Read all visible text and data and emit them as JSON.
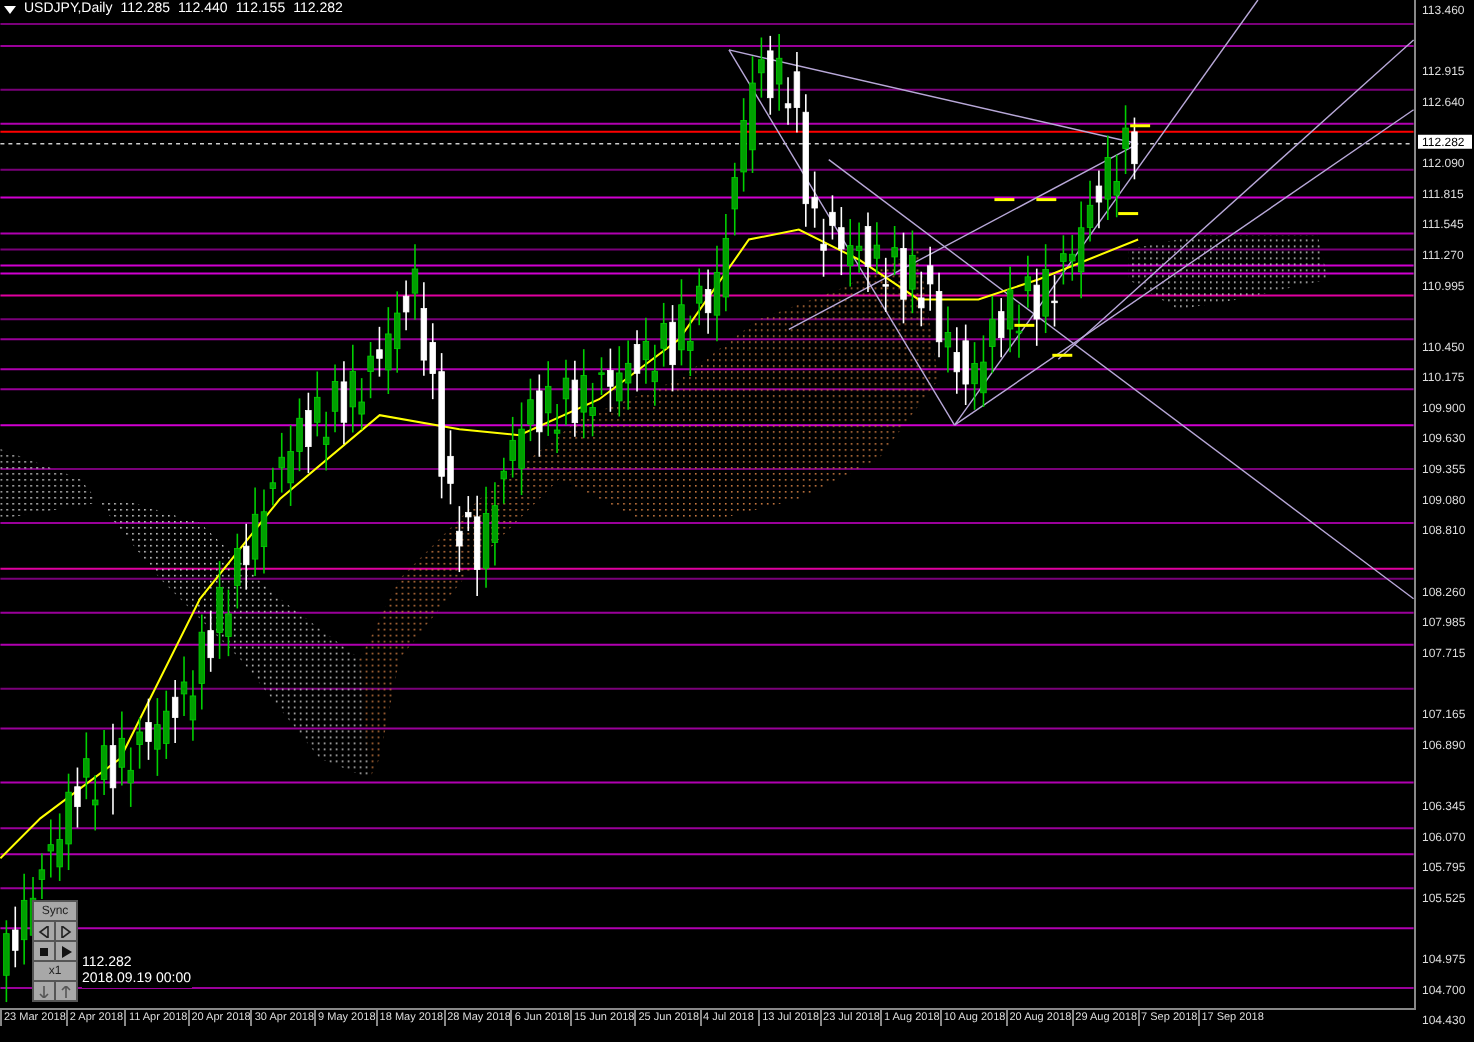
{
  "chart": {
    "symbol_title": "USDJPY,Daily",
    "ohlc": [
      "112.285",
      "112.440",
      "112.155",
      "112.282"
    ]
  },
  "price_axis": {
    "labels": [
      "113.460",
      "112.915",
      "112.640",
      "112.090",
      "111.815",
      "111.545",
      "111.270",
      "110.995",
      "110.450",
      "110.175",
      "109.900",
      "109.630",
      "109.355",
      "109.080",
      "108.810",
      "108.260",
      "107.985",
      "107.715",
      "107.165",
      "106.890",
      "106.345",
      "106.070",
      "105.795",
      "105.525",
      "104.975",
      "104.700",
      "104.430"
    ],
    "current_price": "112.282"
  },
  "time_axis": {
    "labels": [
      "23 Mar 2018",
      "2 Apr 2018",
      "11 Apr 2018",
      "20 Apr 2018",
      "30 Apr 2018",
      "9 May 2018",
      "18 May 2018",
      "28 May 2018",
      "6 Jun 2018",
      "15 Jun 2018",
      "25 Jun 2018",
      "4 Jul 2018",
      "13 Jul 2018",
      "23 Jul 2018",
      "1 Aug 2018",
      "10 Aug 2018",
      "20 Aug 2018",
      "29 Aug 2018",
      "7 Sep 2018",
      "17 Sep 2018"
    ]
  },
  "playback_panel": {
    "sync_label": "Sync",
    "speed": "x1",
    "price": "112.282",
    "time": "2018.09.19 00:00"
  }
}
